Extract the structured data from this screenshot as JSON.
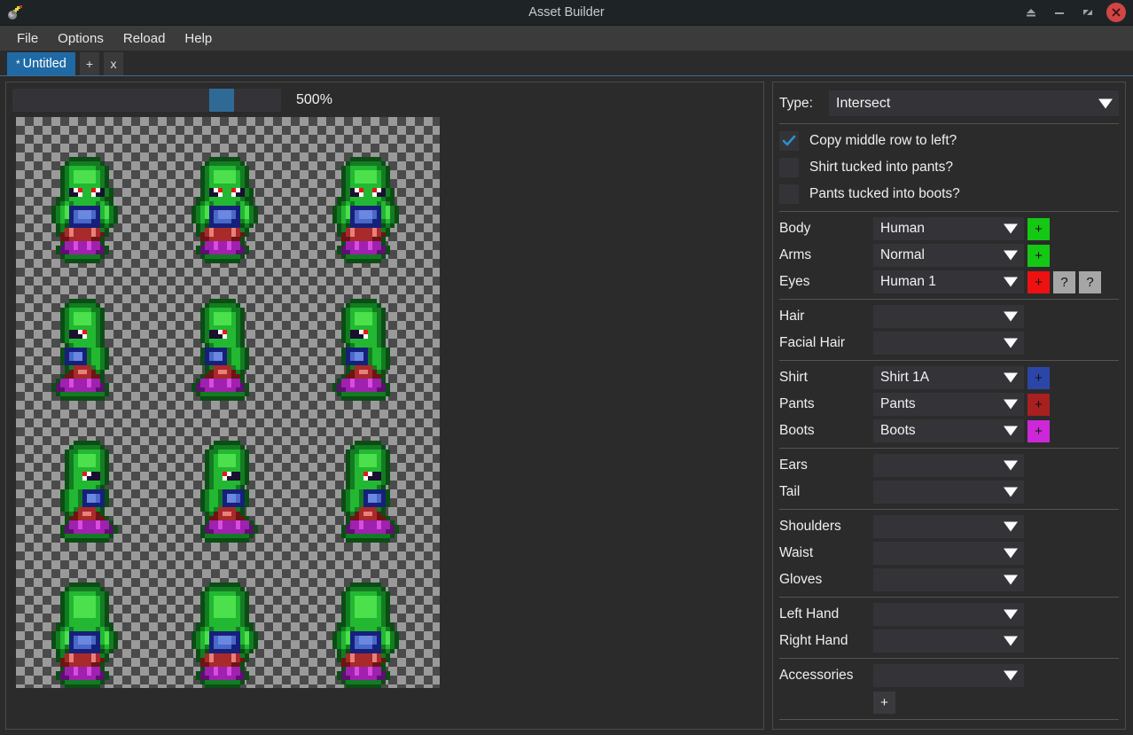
{
  "window": {
    "title": "Asset Builder",
    "icon": "hammer-icon",
    "controls": [
      {
        "name": "eject-button",
        "glyph": "eject-icon"
      },
      {
        "name": "minimize-button",
        "glyph": "minimize-icon"
      },
      {
        "name": "maximize-button",
        "glyph": "maximize-icon"
      },
      {
        "name": "close-button",
        "glyph": "close-icon",
        "color": "#d14545"
      }
    ]
  },
  "menubar": {
    "items": [
      {
        "label": "File"
      },
      {
        "label": "Options"
      },
      {
        "label": "Reload"
      },
      {
        "label": "Help"
      }
    ]
  },
  "tabbar": {
    "tabs": [
      {
        "label": "Untitled",
        "modified_marker": "*",
        "active": true
      }
    ],
    "new_tab_label": "+",
    "close_tab_label": "x"
  },
  "canvas_panel": {
    "zoom_value": "500%",
    "slider": {
      "min": 0,
      "max": 100,
      "value": 75
    }
  },
  "sprite_sheet": {
    "rows": 4,
    "cols": 3,
    "poses": [
      [
        "front-a",
        "front-b",
        "front-c"
      ],
      [
        "side-left-a",
        "side-left-b",
        "side-left-c"
      ],
      [
        "side-right-a",
        "side-right-b",
        "side-right-c"
      ],
      [
        "back-a",
        "back-b",
        "back-c"
      ]
    ],
    "palette": {
      "skin_light": "#4ce04c",
      "skin_mid": "#22b832",
      "skin_dark": "#137c22",
      "outline": "#0b4d14",
      "eye_white": "#ffffff",
      "eye_red": "#e81616",
      "eye_dark": "#1a1030",
      "shirt_light": "#6a88e0",
      "shirt_mid": "#4a68c8",
      "shirt_dark": "#16207a",
      "pants_light": "#e8807a",
      "pants_mid": "#a82a2a",
      "pants_dark": "#6e1414",
      "boots_light": "#d84ce0",
      "boots_mid": "#a020b0",
      "boots_dark": "#5c1070"
    }
  },
  "options_panel": {
    "type": {
      "label": "Type:",
      "value": "Intersect"
    },
    "checkboxes": [
      {
        "label": "Copy middle row to left?",
        "checked": true
      },
      {
        "label": "Shirt tucked into pants?",
        "checked": false
      },
      {
        "label": "Pants tucked into boots?",
        "checked": false
      }
    ],
    "groups": [
      {
        "fields": [
          {
            "label": "Body",
            "value": "Human",
            "buttons": [
              {
                "label": "+",
                "color": "#14c814"
              }
            ]
          },
          {
            "label": "Arms",
            "value": "Normal",
            "buttons": [
              {
                "label": "+",
                "color": "#14c814"
              }
            ]
          },
          {
            "label": "Eyes",
            "value": "Human 1",
            "buttons": [
              {
                "label": "+",
                "color": "#ee1111"
              },
              {
                "label": "?",
                "color": "#a6a6a6"
              },
              {
                "label": "?",
                "color": "#a6a6a6"
              }
            ]
          }
        ]
      },
      {
        "fields": [
          {
            "label": "Hair",
            "value": "",
            "buttons": []
          },
          {
            "label": "Facial Hair",
            "value": "",
            "buttons": []
          }
        ]
      },
      {
        "fields": [
          {
            "label": "Shirt",
            "value": "Shirt 1A",
            "buttons": [
              {
                "label": "+",
                "color": "#2c46a8"
              }
            ]
          },
          {
            "label": "Pants",
            "value": "Pants",
            "buttons": [
              {
                "label": "+",
                "color": "#a82020"
              }
            ]
          },
          {
            "label": "Boots",
            "value": "Boots",
            "buttons": [
              {
                "label": "+",
                "color": "#cc28d8"
              }
            ]
          }
        ]
      },
      {
        "fields": [
          {
            "label": "Ears",
            "value": "",
            "buttons": []
          },
          {
            "label": "Tail",
            "value": "",
            "buttons": []
          }
        ]
      },
      {
        "fields": [
          {
            "label": "Shoulders",
            "value": "",
            "buttons": []
          },
          {
            "label": "Waist",
            "value": "",
            "buttons": []
          },
          {
            "label": "Gloves",
            "value": "",
            "buttons": []
          }
        ]
      },
      {
        "fields": [
          {
            "label": "Left Hand",
            "value": "",
            "buttons": []
          },
          {
            "label": "Right Hand",
            "value": "",
            "buttons": []
          }
        ]
      },
      {
        "fields": [
          {
            "label": "Accessories",
            "value": "",
            "buttons": []
          }
        ],
        "add_button": "+"
      }
    ]
  }
}
